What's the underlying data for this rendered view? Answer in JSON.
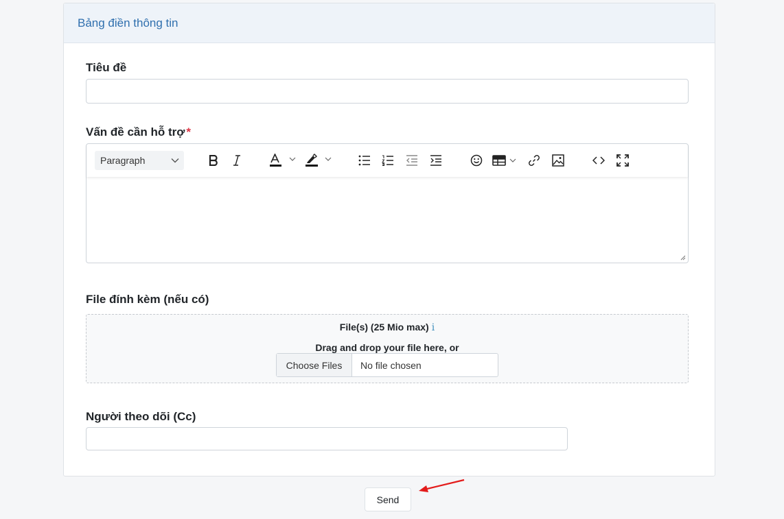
{
  "form": {
    "title": "Bảng điền thông tin",
    "subject": {
      "label": "Tiêu đề",
      "value": "",
      "placeholder": ""
    },
    "issue": {
      "label": "Vấn đề cần hỗ trợ",
      "required_mark": "*"
    },
    "editor": {
      "format_select": "Paragraph",
      "toolbar_icons": [
        "bold-icon",
        "italic-icon",
        "font-color-icon",
        "highlight-icon",
        "bulleted-list-icon",
        "numbered-list-icon",
        "outdent-icon",
        "indent-icon",
        "emoji-icon",
        "table-icon",
        "link-icon",
        "image-icon",
        "source-code-icon",
        "fullscreen-icon"
      ],
      "content": ""
    },
    "attachment": {
      "label": "File đính kèm (nếu có)",
      "dropzone_title": "File(s) (25 Mio max)",
      "info_glyph": "i",
      "dropzone_hint": "Drag and drop your file here, or",
      "choose_button": "Choose Files",
      "file_status": "No file chosen"
    },
    "cc": {
      "label": "Người theo dõi (Cc)",
      "value": "",
      "placeholder": ""
    }
  },
  "actions": {
    "send_label": "Send"
  },
  "colors": {
    "header_bg": "#eef3f9",
    "header_text": "#2f6fae",
    "required": "#dc3545",
    "annotation_arrow": "#e31b1b"
  }
}
